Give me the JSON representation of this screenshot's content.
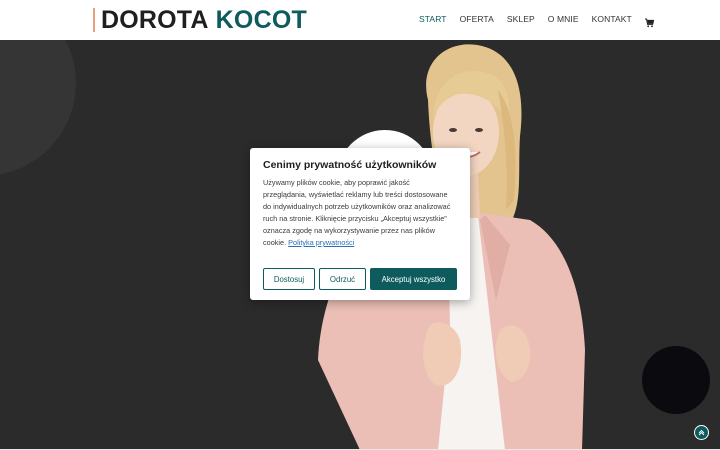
{
  "header": {
    "logo_first": "DOROTA",
    "logo_last": "KOCOT",
    "nav": [
      "START",
      "OFERTA",
      "SKLEP",
      "O MNIE",
      "KONTAKT"
    ],
    "cart_icon": "cart-icon"
  },
  "cookie": {
    "title": "Cenimy prywatność użytkowników",
    "text": "Używamy plików cookie, aby poprawić jakość przeglądania, wyświetlać reklamy lub treści dostosowane do indywidualnych potrzeb użytkowników oraz analizować ruch na stronie. Kliknięcie przycisku „Akceptuj wszystkie” oznacza zgodę na wykorzystywanie przez nas plików cookie.",
    "policy_link": "Polityka prywatności",
    "btn_customize": "Dostosuj",
    "btn_reject": "Odrzuć",
    "btn_accept": "Akceptuj wszystko"
  },
  "colors": {
    "accent": "#0e5b5e",
    "hero_bg": "#2b2b2b"
  },
  "scroll_top_icon": "arrow-up-icon"
}
